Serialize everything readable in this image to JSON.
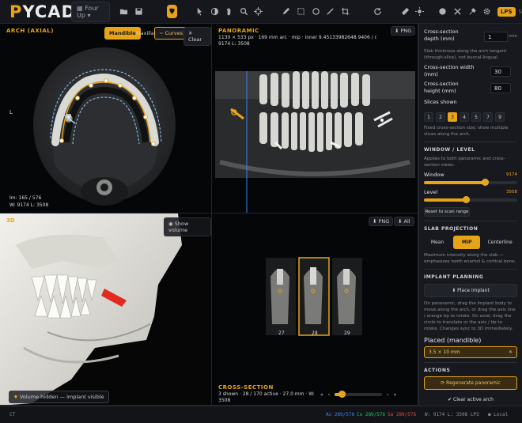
{
  "app": {
    "logo_accent": "P",
    "logo_rest": "YCAD",
    "layout_label": "Four Up"
  },
  "toolbar": {
    "coord_label": "LPS",
    "coord_suffix": "S",
    "icons": [
      "folder-icon",
      "save-icon",
      "tooth-icon",
      "pointer-icon",
      "contrast-icon",
      "pan-icon",
      "zoom-icon",
      "crosshair-icon",
      "pen-icon",
      "select-icon",
      "circle-icon",
      "line-icon",
      "crop-icon",
      "refresh-icon",
      "ruler-icon",
      "brightness-icon",
      "invert-icon",
      "contrast-icon",
      "tools-icon",
      "settings-icon"
    ]
  },
  "axial": {
    "title": "ARCH (AXIAL)",
    "btn_mandible": "Mandible",
    "btn_maxilla": "Maxilla",
    "btn_curves": "Curves",
    "btn_clear": "Clear",
    "orient_label": "L",
    "info_line1": "Im: 165 / 576",
    "info_line2": "W: 9174 L: 3508"
  },
  "panoramic": {
    "title": "PANORAMIC",
    "info_line1": "1130 × 533 px · 169 mm arc · mip · inner 9.45133982648 9406 / outer 8.78658632660 80 lo oss · wi",
    "info_line2": "9174 L: 3508",
    "png_label": "PNG"
  },
  "render3d": {
    "corner_label": "3D",
    "show_volume_label": "Show volume",
    "hidden_label": "Volume hidden — implant visible"
  },
  "cross": {
    "png_label": "PNG",
    "all_label": "All",
    "thumb_labels": [
      "27",
      "28",
      "29"
    ],
    "title": "CROSS-SECTION",
    "info": "3 shown · 28 / 170 active · 27.0 mm · W: 9174 L:",
    "info2": "3508",
    "slider_value": 0.16
  },
  "panel": {
    "depth_label": "Cross-section depth (mm)",
    "depth_value": "1",
    "depth_unit": "mm",
    "depth_help": "Slab thickness along the arch tangent (through-slice), not buccal-lingual.",
    "width_label": "Cross-section width (mm)",
    "width_value": "30",
    "height_label": "Cross-section height (mm)",
    "height_value": "80",
    "slices_label": "Slices shown",
    "slices": [
      "1",
      "2",
      "3",
      "4",
      "5",
      "7",
      "9"
    ],
    "slices_active": "3",
    "slices_help": "Fixed cross-section size; show multiple slices along the arch.",
    "wl_header": "WINDOW / LEVEL",
    "wl_help": "Applies to both panoramic and cross-section views.",
    "window_label": "Window",
    "window_value": "9174",
    "window_fraction": 0.66,
    "level_label": "Level",
    "level_value": "3508",
    "level_fraction": 0.45,
    "reset_label": "Reset to scan range",
    "slab_header": "SLAB PROJECTION",
    "slab_mean": "Mean",
    "slab_mip": "MIP",
    "slab_centerline": "Centerline",
    "slab_help": "Maximum intensity along the slab — emphasizes tooth enamel & cortical bone.",
    "implant_header": "IMPLANT PLANNING",
    "place_btn": "Place implant",
    "implant_help": "On panoramic, drag the implant body to move along the arch, or drag the axis line / orange tip to rotate. On axial, drag the circle to translate or the axis / tip to rotate. Changes sync to 3D immediately.",
    "placed_label": "Placed (mandible)",
    "placed_item": "3.5 × 10 mm",
    "actions_header": "ACTIONS",
    "regen_label": "Regenerate panoramic",
    "clear_arch_label": "Clear active arch"
  },
  "status": {
    "left": "CT",
    "ax": "Ax 289/576",
    "co": "Co 289/576",
    "sa": "Sa 289/576",
    "wl": "W: 9174  L: 3508",
    "lps": "LPS",
    "local": "● Local"
  },
  "colors": {
    "accent": "#e8a418",
    "ax": "#3b82f6",
    "co": "#22c55e",
    "sa": "#ef4444"
  }
}
